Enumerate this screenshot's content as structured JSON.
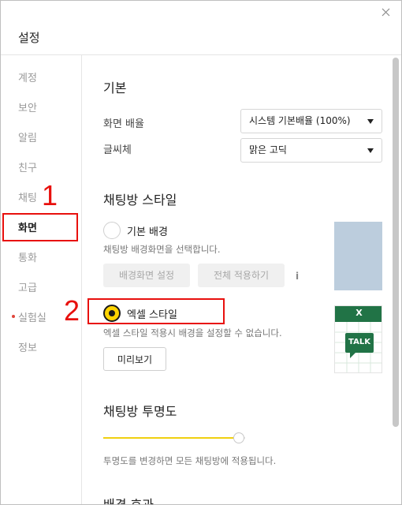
{
  "window": {
    "title": "설정"
  },
  "sidebar": {
    "items": [
      {
        "label": "계정"
      },
      {
        "label": "보안"
      },
      {
        "label": "알림"
      },
      {
        "label": "친구"
      },
      {
        "label": "채팅"
      },
      {
        "label": "화면",
        "active": true
      },
      {
        "label": "통화"
      },
      {
        "label": "고급"
      },
      {
        "label": "실험실",
        "badge": "new-dot"
      },
      {
        "label": "정보"
      }
    ]
  },
  "annotations": {
    "marker_1": "1",
    "marker_2": "2",
    "color": "#e8100d"
  },
  "content": {
    "basic": {
      "heading": "기본",
      "zoom_label": "화면 배율",
      "zoom_value": "시스템 기본배율 (100%)",
      "font_label": "글씨체",
      "font_value": "맑은 고딕"
    },
    "chatroom_style": {
      "heading": "채팅방 스타일",
      "basic_bg_label": "기본 배경",
      "basic_bg_hint": "채팅방 배경화면을 선택합니다.",
      "set_bg_button": "배경화면 설정",
      "apply_all_button": "전체 적용하기",
      "info_icon": "i",
      "excel_label": "엑셀 스타일",
      "excel_hint": "엑셀 스타일 적용시 배경을 설정할 수 없습니다.",
      "preview_button": "미리보기",
      "excel_thumb_x": "X",
      "excel_thumb_talk": "TALK",
      "selected": "excel",
      "basic_thumb_color": "#bccddd",
      "excel_green": "#217346"
    },
    "transparency": {
      "heading": "채팅방 투명도",
      "hint": "투명도를 변경하면 모든 채팅방에 적용됩니다.",
      "slider_fraction": 0.96,
      "accent": "#f0d010"
    },
    "next_heading": "배경 효과"
  }
}
